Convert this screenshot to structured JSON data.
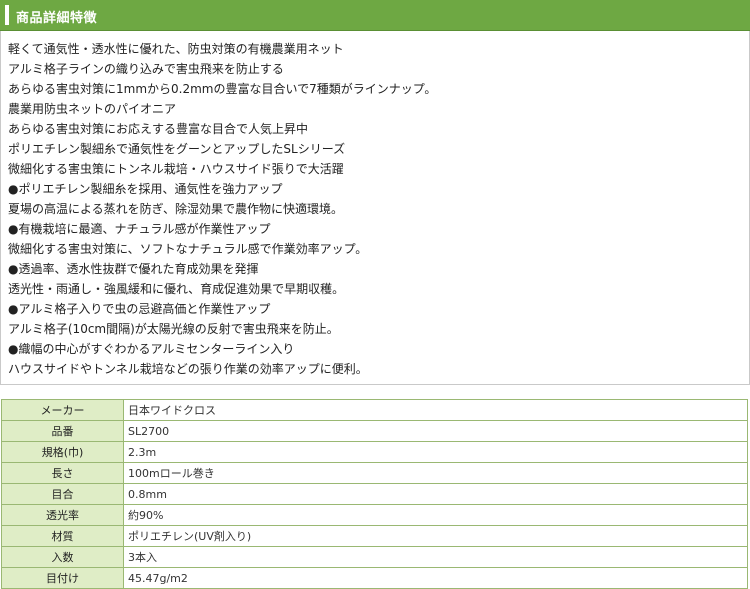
{
  "header": {
    "title": "商品詳細特徴"
  },
  "description": [
    "軽くて通気性・透水性に優れた、防虫対策の有機農業用ネット",
    "アルミ格子ラインの織り込みで害虫飛来を防止する",
    "あらゆる害虫対策に1mmから0.2mmの豊富な目合いで7種類がラインナップ。",
    "農業用防虫ネットのパイオニア",
    "あらゆる害虫対策にお応えする豊富な目合で人気上昇中",
    "ポリエチレン製細糸で通気性をグーンとアップしたSLシリーズ",
    "微細化する害虫策にトンネル栽培・ハウスサイド張りで大活躍",
    "●ポリエチレン製細糸を採用、通気性を強力アップ",
    "夏場の高温による蒸れを防ぎ、除湿効果で農作物に快適環境。",
    "●有機栽培に最適、ナチュラル感が作業性アップ",
    "微細化する害虫対策に、ソフトなナチュラル感で作業効率アップ。",
    "●透過率、透水性抜群で優れた育成効果を発揮",
    "透光性・雨通し・強風緩和に優れ、育成促進効果で早期収穫。",
    "●アルミ格子入りで虫の忌避高価と作業性アップ",
    "アルミ格子(10cm間隔)が太陽光線の反射で害虫飛来を防止。",
    "●織幅の中心がすぐわかるアルミセンターライン入り",
    "ハウスサイドやトンネル栽培などの張り作業の効率アップに便利。"
  ],
  "specs": [
    {
      "label": "メーカー",
      "value": "日本ワイドクロス"
    },
    {
      "label": "品番",
      "value": "SL2700"
    },
    {
      "label": "規格(巾)",
      "value": "2.3m"
    },
    {
      "label": "長さ",
      "value": "100mロール巻き"
    },
    {
      "label": "目合",
      "value": "0.8mm"
    },
    {
      "label": "透光率",
      "value": "約90%"
    },
    {
      "label": "材質",
      "value": "ポリエチレン(UV剤入り)"
    },
    {
      "label": "入数",
      "value": "3本入"
    },
    {
      "label": "目付け",
      "value": "45.47g/m2"
    }
  ],
  "colors": {
    "header_bg": "#6ea843",
    "label_bg": "#dfedc6",
    "table_border": "#9ab873"
  }
}
